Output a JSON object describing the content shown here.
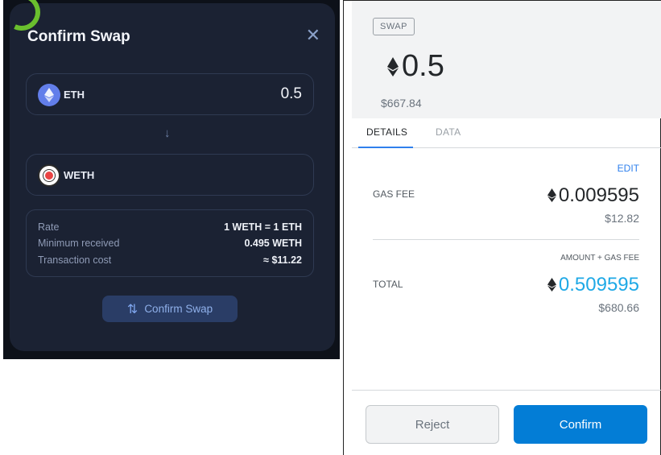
{
  "left_modal": {
    "title": "Confirm Swap",
    "close_icon": "close-icon",
    "from_token": {
      "symbol": "ETH",
      "amount": "0.5",
      "icon": "eth-icon"
    },
    "to_token": {
      "symbol": "WETH",
      "icon": "weth-icon"
    },
    "arrow_icon": "arrow-down-icon",
    "details": [
      {
        "label": "Rate",
        "value": "1 WETH = 1 ETH"
      },
      {
        "label": "Minimum received",
        "value": "0.495 WETH"
      },
      {
        "label": "Transaction cost",
        "value": "≈ $11.22"
      }
    ],
    "confirm_button": "Confirm Swap",
    "colors": {
      "accent": "#2a3d66",
      "panel": "#1b2233",
      "highlight_ring": "#6abf2e"
    }
  },
  "right_panel": {
    "badge": "SWAP",
    "amount": "0.5",
    "fiat": "$667.84",
    "tabs": [
      {
        "label": "DETAILS",
        "active": true
      },
      {
        "label": "DATA",
        "active": false
      }
    ],
    "edit_label": "EDIT",
    "gas_fee": {
      "label": "GAS FEE",
      "eth": "0.009595",
      "fiat": "$12.82"
    },
    "amount_plus_gas_label": "AMOUNT + GAS FEE",
    "total": {
      "label": "TOTAL",
      "eth": "0.509595",
      "fiat": "$680.66"
    },
    "reject_button": "Reject",
    "confirm_button": "Confirm",
    "colors": {
      "primary": "#037dd6",
      "total_text": "#1fa9e6",
      "link": "#2f80ed"
    }
  }
}
